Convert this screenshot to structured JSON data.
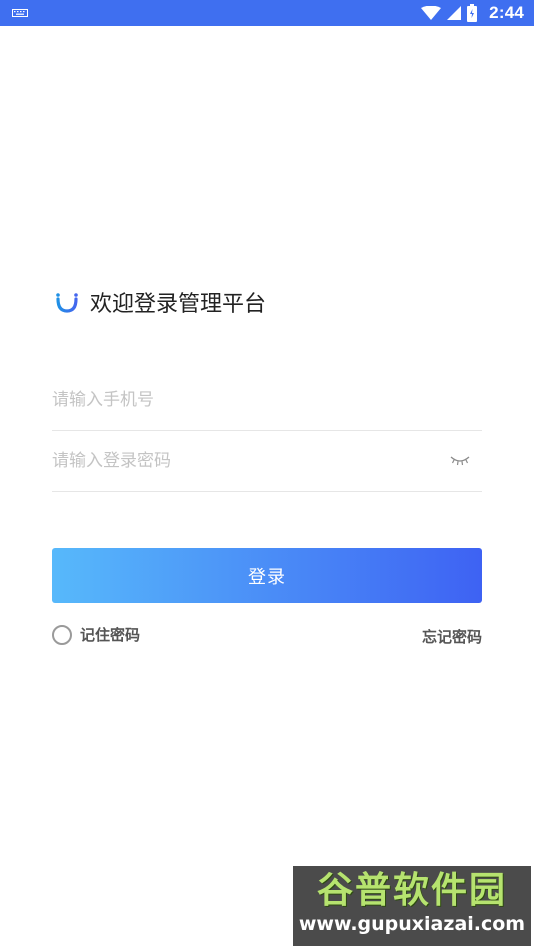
{
  "status_bar": {
    "time": "2:44",
    "icons": [
      "keyboard-icon",
      "wifi-icon",
      "signal-icon",
      "battery-icon"
    ]
  },
  "login": {
    "title": "欢迎登录管理平台",
    "phone_placeholder": "请输入手机号",
    "password_placeholder": "请输入登录密码",
    "login_button": "登录",
    "remember_label": "记住密码",
    "forgot_label": "忘记密码"
  },
  "watermark": {
    "text_cn": "谷普软件园",
    "url": "www.gupuxiazai.com"
  },
  "colors": {
    "status_bar": "#3f6ff0",
    "button_gradient_start": "#57b9fb",
    "button_gradient_end": "#3e62f3",
    "logo_left": "#1f90e5",
    "logo_right": "#4466ee"
  }
}
